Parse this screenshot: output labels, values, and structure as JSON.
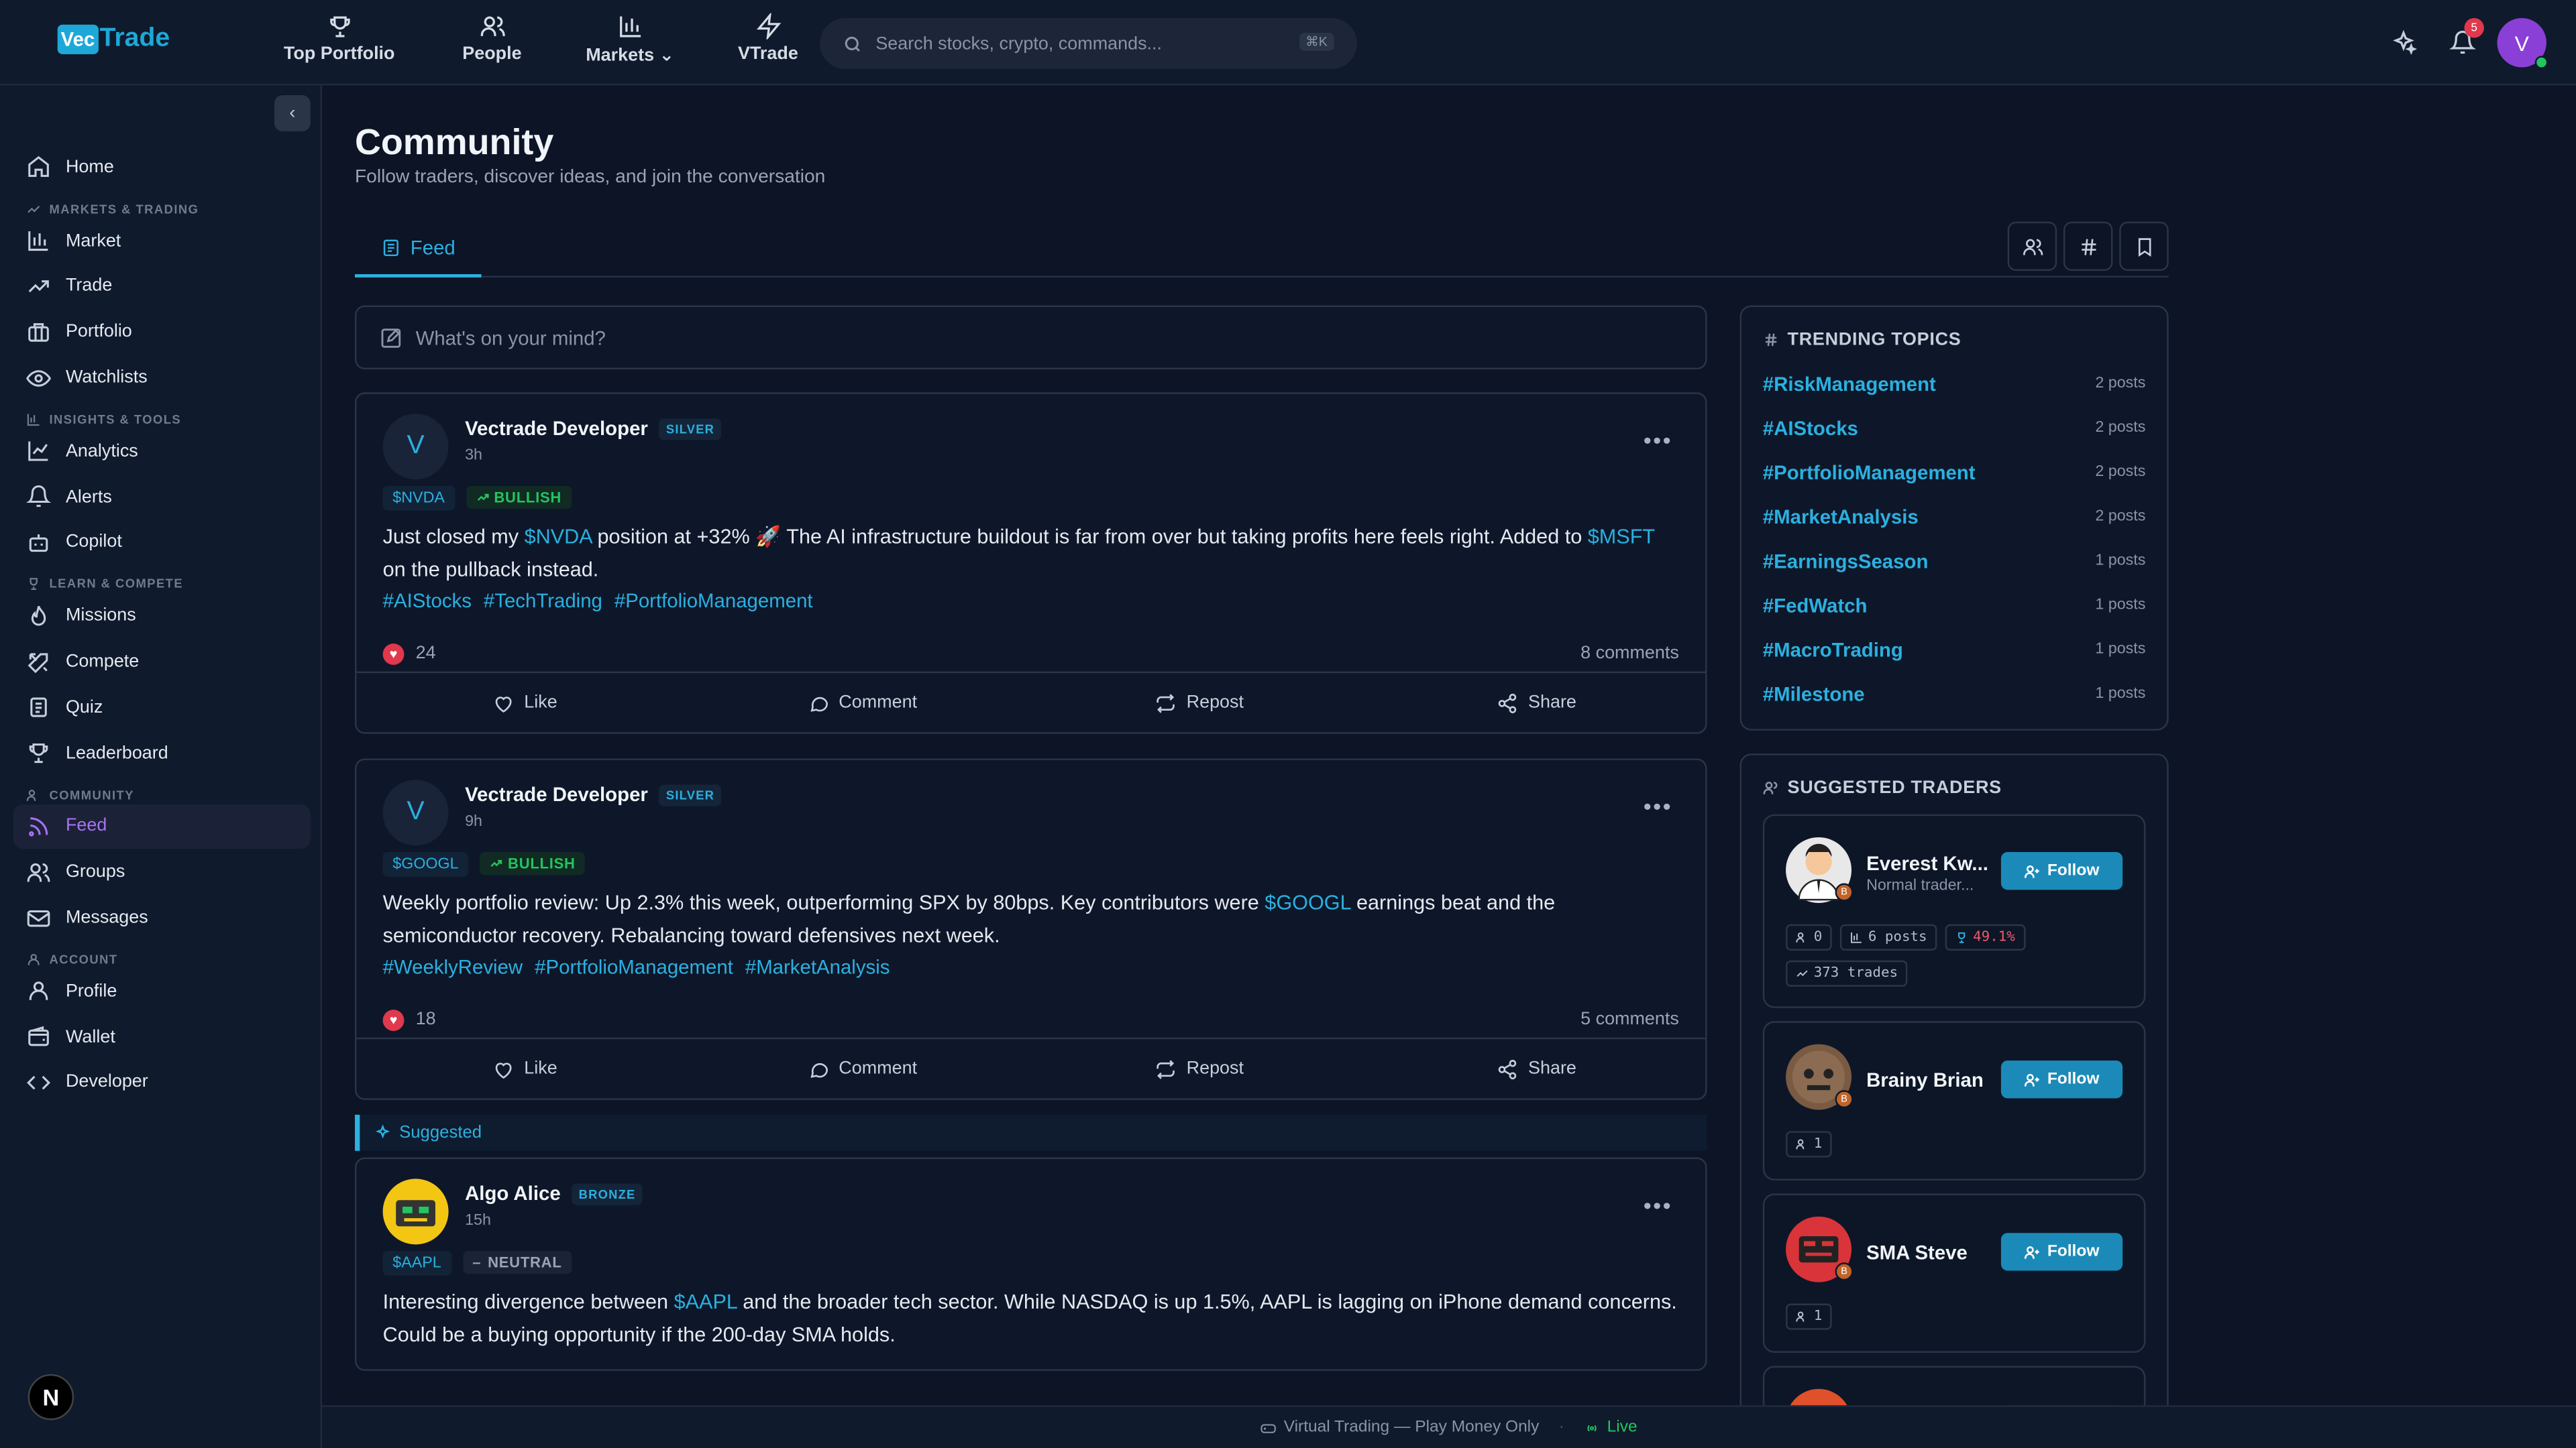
{
  "logo": {
    "vec": "Vec",
    "trade": "Trade"
  },
  "topnav": [
    {
      "label": "Top Portfolio",
      "icon": "trophy-icon"
    },
    {
      "label": "People",
      "icon": "users-icon"
    },
    {
      "label": "Markets",
      "icon": "bar-chart-icon"
    },
    {
      "label": "VTrade",
      "icon": "bolt-icon"
    }
  ],
  "search": {
    "placeholder": "Search stocks, crypto, commands...",
    "shortcut": "⌘K"
  },
  "notifications": {
    "count": "5"
  },
  "user": {
    "initial": "V"
  },
  "sidebar": {
    "home": "Home",
    "sections": {
      "markets": "MARKETS & TRADING",
      "insights": "INSIGHTS & TOOLS",
      "learn": "LEARN & COMPETE",
      "community": "COMMUNITY",
      "account": "ACCOUNT"
    },
    "items": {
      "market": "Market",
      "trade": "Trade",
      "portfolio": "Portfolio",
      "watchlists": "Watchlists",
      "analytics": "Analytics",
      "alerts": "Alerts",
      "copilot": "Copilot",
      "missions": "Missions",
      "compete": "Compete",
      "quiz": "Quiz",
      "leaderboard": "Leaderboard",
      "feed": "Feed",
      "groups": "Groups",
      "messages": "Messages",
      "profile": "Profile",
      "wallet": "Wallet",
      "developer": "Developer"
    }
  },
  "page": {
    "title": "Community",
    "subtitle": "Follow traders, discover ideas, and join the conversation"
  },
  "tabs": {
    "feed": "Feed"
  },
  "composer": {
    "placeholder": "What's on your mind?"
  },
  "actions": {
    "like": "Like",
    "comment": "Comment",
    "repost": "Repost",
    "share": "Share"
  },
  "posts": [
    {
      "avatar": "V",
      "author": "Vectrade Developer",
      "tier": "SILVER",
      "time": "3h",
      "ticker": "$NVDA",
      "sentiment": "BULLISH",
      "text_a": "Just closed my ",
      "mention_a": "$NVDA",
      "text_b": " position at +32% 🚀 The AI infrastructure buildout is far from over but taking profits here feels right. Added to ",
      "mention_b": "$MSFT",
      "text_c": " on the pullback instead.",
      "hashtags": [
        "#AIStocks",
        "#TechTrading",
        "#PortfolioManagement"
      ],
      "likes": "24",
      "comments": "8 comments"
    },
    {
      "avatar": "V",
      "author": "Vectrade Developer",
      "tier": "SILVER",
      "time": "9h",
      "ticker": "$GOOGL",
      "sentiment": "BULLISH",
      "text_a": "Weekly portfolio review: Up 2.3% this week, outperforming SPX by 80bps. Key contributors were ",
      "mention_a": "$GOOGL",
      "text_b": " earnings beat and the semiconductor recovery. Rebalancing toward defensives next week.",
      "hashtags": [
        "#WeeklyReview",
        "#PortfolioManagement",
        "#MarketAnalysis"
      ],
      "likes": "18",
      "comments": "5 comments"
    },
    {
      "suggested_label": "Suggested",
      "author": "Algo Alice",
      "tier": "BRONZE",
      "time": "15h",
      "ticker": "$AAPL",
      "sentiment": "NEUTRAL",
      "text_a": "Interesting divergence between ",
      "mention_a": "$AAPL",
      "text_b": " and the broader tech sector. While NASDAQ is up 1.5%, AAPL is lagging on iPhone demand concerns. Could be a buying opportunity if the 200-day SMA holds."
    }
  ],
  "trending": {
    "title": "TRENDING TOPICS",
    "topics": [
      {
        "name": "#RiskManagement",
        "count": "2 posts"
      },
      {
        "name": "#AIStocks",
        "count": "2 posts"
      },
      {
        "name": "#PortfolioManagement",
        "count": "2 posts"
      },
      {
        "name": "#MarketAnalysis",
        "count": "2 posts"
      },
      {
        "name": "#EarningsSeason",
        "count": "1 posts"
      },
      {
        "name": "#FedWatch",
        "count": "1 posts"
      },
      {
        "name": "#MacroTrading",
        "count": "1 posts"
      },
      {
        "name": "#Milestone",
        "count": "1 posts"
      }
    ]
  },
  "suggested": {
    "title": "SUGGESTED TRADERS",
    "follow": "Follow",
    "traders": [
      {
        "name": "Everest Kw...",
        "sub": "Normal trader...",
        "followers": "0",
        "posts": "6 posts",
        "return": "49.1%",
        "trades": "373 trades"
      },
      {
        "name": "Brainy Brian",
        "followers": "1"
      },
      {
        "name": "SMA Steve",
        "followers": "1"
      }
    ]
  },
  "footer": {
    "mode": "Virtual Trading — Play Money Only",
    "sep": "·",
    "live": "Live"
  },
  "colors": {
    "accent": "#2bb0e0",
    "active_nav": "#a971f2",
    "bullish": "#22c55e",
    "like": "#e0384c"
  }
}
